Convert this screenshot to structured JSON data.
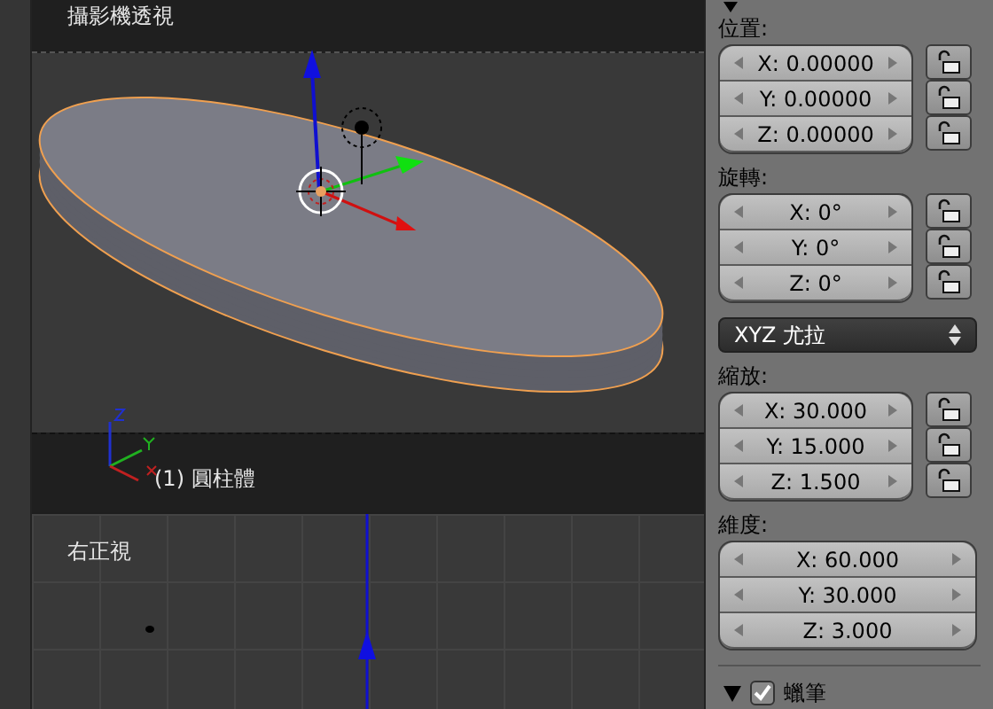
{
  "viewport_camera": {
    "title": "攝影機透視",
    "object_label": "(1) 圓柱體"
  },
  "viewport_right": {
    "title": "右正視"
  },
  "panel": {
    "expanded": true,
    "sections": [
      {
        "kind": "vector",
        "label": "位置:",
        "fields": [
          {
            "text": "X: 0.00000",
            "locked": false
          },
          {
            "text": "Y: 0.00000",
            "locked": false
          },
          {
            "text": "Z: 0.00000",
            "locked": false
          }
        ]
      },
      {
        "kind": "vector",
        "label": "旋轉:",
        "fields": [
          {
            "text": "X: 0°",
            "locked": false
          },
          {
            "text": "Y: 0°",
            "locked": false
          },
          {
            "text": "Z: 0°",
            "locked": false
          }
        ]
      },
      {
        "kind": "dropdown",
        "value": "XYZ 尤拉"
      },
      {
        "kind": "vector",
        "label": "縮放:",
        "fields": [
          {
            "text": "X: 30.000",
            "locked": false
          },
          {
            "text": "Y: 15.000",
            "locked": false
          },
          {
            "text": "Z: 1.500",
            "locked": false
          }
        ]
      },
      {
        "kind": "plain",
        "label": "維度:",
        "fields": [
          {
            "text": "X: 60.000"
          },
          {
            "text": "Y: 30.000"
          },
          {
            "text": "Z: 3.000"
          }
        ]
      }
    ]
  },
  "subpanel": {
    "header": "蠟筆",
    "expanded": true,
    "checked": true
  }
}
